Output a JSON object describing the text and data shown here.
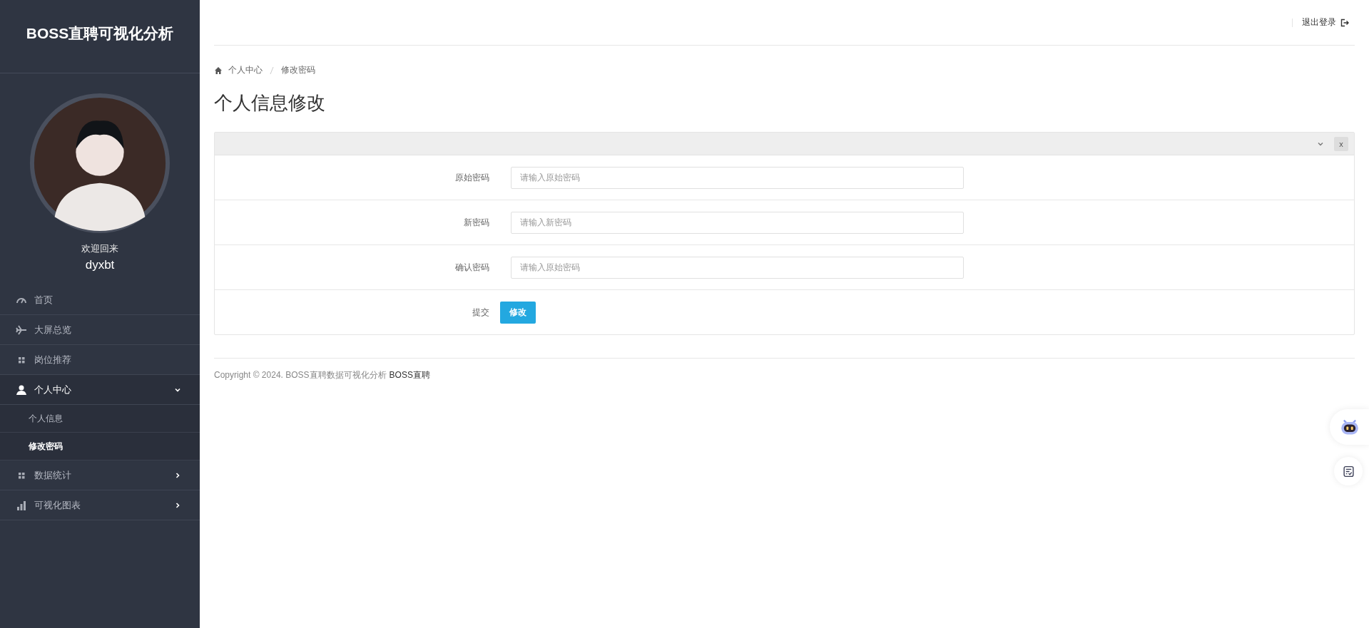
{
  "sidebar": {
    "title": "BOSS直聘可视化分析",
    "greeting": "欢迎回来",
    "username": "dyxbt",
    "menu": [
      {
        "label": "首页",
        "kind": "gauge",
        "selected": false
      },
      {
        "label": "大屏总览",
        "kind": "plane",
        "selected": false
      },
      {
        "label": "岗位推荐",
        "kind": "grid",
        "selected": false
      },
      {
        "label": "个人中心",
        "kind": "user",
        "selected": true,
        "expanded": true,
        "children": [
          {
            "label": "个人信息",
            "selected": false
          },
          {
            "label": "修改密码",
            "selected": true
          }
        ]
      },
      {
        "label": "数据统计",
        "kind": "grid",
        "selected": false,
        "expanded": false
      },
      {
        "label": "可视化图表",
        "kind": "bars",
        "selected": false,
        "expanded": false
      }
    ]
  },
  "header": {
    "logout": "退出登录"
  },
  "breadcrumb": [
    "个人中心",
    "修改密码"
  ],
  "page_title": "个人信息修改",
  "panel": {
    "close": "x",
    "rows": [
      {
        "kind": "input",
        "label": "原始密码",
        "placeholder": "请输入原始密码"
      },
      {
        "kind": "input",
        "label": "新密码",
        "placeholder": "请输入新密码"
      },
      {
        "kind": "input",
        "label": "确认密码",
        "placeholder": "请输入原始密码"
      },
      {
        "kind": "submit",
        "label": "提交",
        "button": "修改"
      }
    ]
  },
  "footer": {
    "copyright": "Copyright © 2024. BOSS直聘数据可视化分析",
    "brand": "BOSS直聘"
  }
}
